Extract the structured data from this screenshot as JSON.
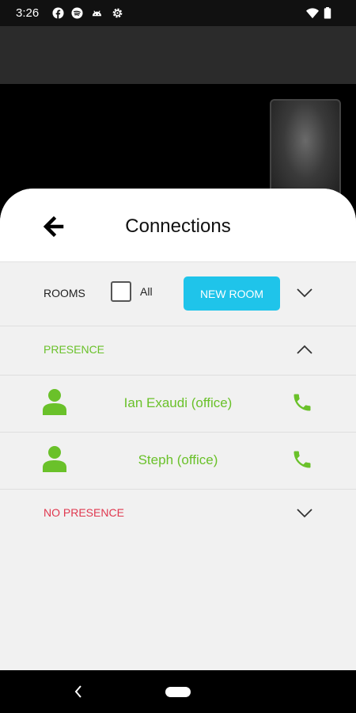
{
  "status_bar": {
    "time": "3:26",
    "left_icons": [
      "facebook-icon",
      "spotify-icon",
      "android-icon",
      "settings-icon"
    ],
    "right_icons": [
      "wifi-icon",
      "battery-icon"
    ]
  },
  "header": {
    "title": "Connections",
    "back_icon": "arrow-left-icon"
  },
  "rooms_bar": {
    "rooms_label": "ROOMS",
    "all_label": "All",
    "all_checked": false,
    "new_room_label": "NEW ROOM",
    "expand_icon": "chevron-down-icon"
  },
  "presence": {
    "title": "PRESENCE",
    "expanded": true,
    "contacts": [
      {
        "name": "Ian Exaudi (office)"
      },
      {
        "name": "Steph (office)"
      }
    ]
  },
  "no_presence": {
    "title": "NO PRESENCE",
    "expanded": false
  },
  "colors": {
    "accent_button": "#1fc4ea",
    "presence_green": "#6ac12a",
    "no_presence_red": "#e0384f"
  }
}
